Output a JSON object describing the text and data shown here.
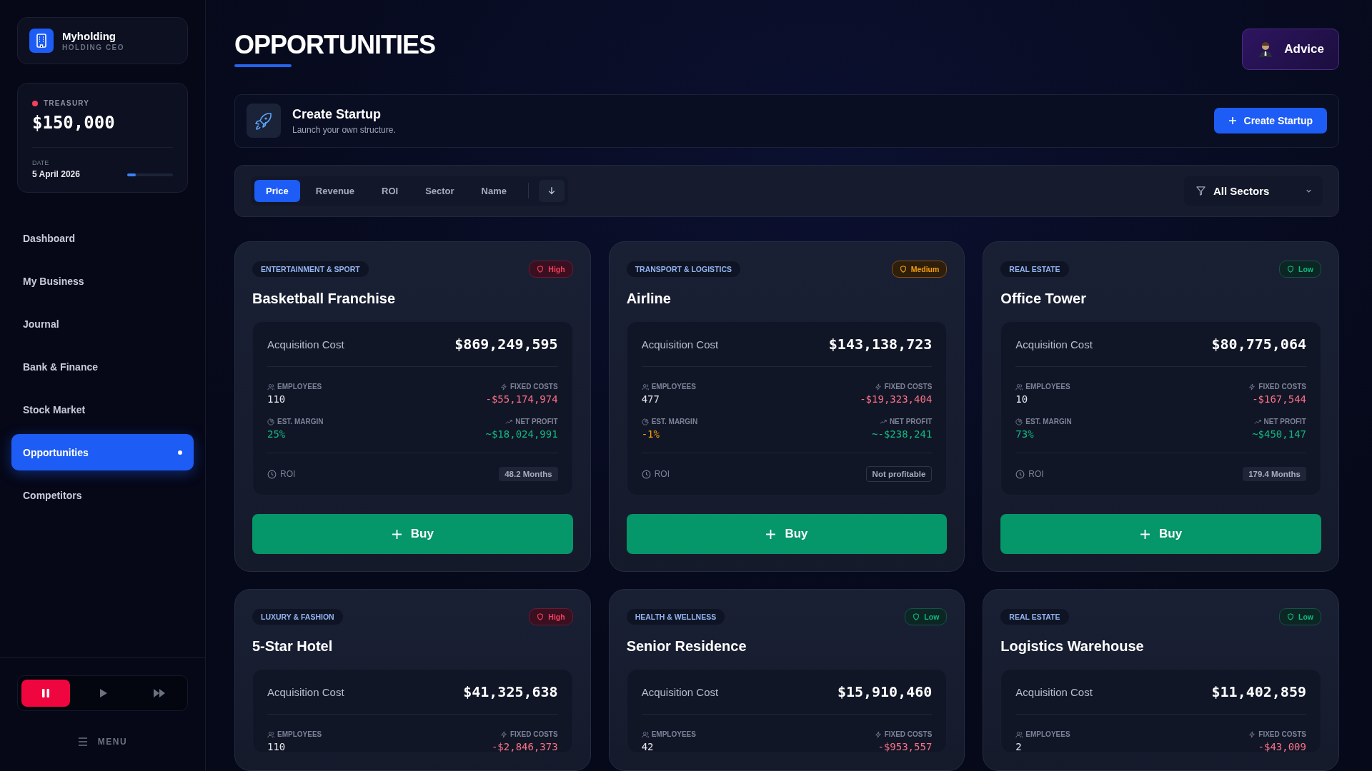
{
  "sidebar": {
    "company": {
      "name": "Myholding",
      "role": "HOLDING CEO"
    },
    "treasury": {
      "label": "TREASURY",
      "color": "#f43f5e",
      "amount": "$150,000",
      "date_label": "DATE",
      "date": "5 April 2026",
      "level": 0.18
    },
    "nav": [
      {
        "label": "Dashboard",
        "selected": false
      },
      {
        "label": "My Business",
        "selected": false
      },
      {
        "label": "Journal",
        "selected": false
      },
      {
        "label": "Bank & Finance",
        "selected": false
      },
      {
        "label": "Stock Market",
        "selected": false
      },
      {
        "label": "Opportunities",
        "selected": true
      },
      {
        "label": "Competitors",
        "selected": false
      }
    ],
    "player": [
      {
        "kind": "pause",
        "selected": true
      },
      {
        "kind": "play",
        "selected": false
      },
      {
        "kind": "fast",
        "selected": false
      }
    ],
    "menu": "MENU"
  },
  "header": {
    "title": "OPPORTUNITIES",
    "advice": "Advice"
  },
  "startup": {
    "title": "Create Startup",
    "subtitle": "Launch your own structure.",
    "button": "Create Startup"
  },
  "sort": {
    "options": [
      {
        "label": "Price",
        "selected": true
      },
      {
        "label": "Revenue",
        "selected": false
      },
      {
        "label": "ROI",
        "selected": false
      },
      {
        "label": "Sector",
        "selected": false
      },
      {
        "label": "Name",
        "selected": false
      }
    ],
    "sector_filter": "All Sectors"
  },
  "cards": [
    {
      "sector": "ENTERTAINMENT & SPORT",
      "risk": {
        "kind": "high",
        "label": "High"
      },
      "title": "Basketball Franchise",
      "cost_label": "Acquisition Cost",
      "cost": "$869,249,595",
      "employees_label": "EMPLOYEES",
      "employees": "110",
      "fixed_label": "FIXED COSTS",
      "fixed": "-$55,174,974",
      "margin_label": "EST. MARGIN",
      "margin": {
        "kind": "positive",
        "value": "25%"
      },
      "profit_label": "NET PROFIT",
      "profit": "~$18,024,991",
      "roi_label": "ROI",
      "roi": {
        "kind": "months",
        "value": "48.2 Months"
      },
      "buy": "Buy"
    },
    {
      "sector": "TRANSPORT & LOGISTICS",
      "risk": {
        "kind": "medium",
        "label": "Medium"
      },
      "title": "Airline",
      "cost_label": "Acquisition Cost",
      "cost": "$143,138,723",
      "employees_label": "EMPLOYEES",
      "employees": "477",
      "fixed_label": "FIXED COSTS",
      "fixed": "-$19,323,404",
      "margin_label": "EST. MARGIN",
      "margin": {
        "kind": "negative",
        "value": "-1%"
      },
      "profit_label": "NET PROFIT",
      "profit": "~-$238,241",
      "roi_label": "ROI",
      "roi": {
        "kind": "none",
        "value": "Not profitable"
      },
      "buy": "Buy"
    },
    {
      "sector": "REAL ESTATE",
      "risk": {
        "kind": "low",
        "label": "Low"
      },
      "title": "Office Tower",
      "cost_label": "Acquisition Cost",
      "cost": "$80,775,064",
      "employees_label": "EMPLOYEES",
      "employees": "10",
      "fixed_label": "FIXED COSTS",
      "fixed": "-$167,544",
      "margin_label": "EST. MARGIN",
      "margin": {
        "kind": "positive",
        "value": "73%"
      },
      "profit_label": "NET PROFIT",
      "profit": "~$450,147",
      "roi_label": "ROI",
      "roi": {
        "kind": "months",
        "value": "179.4 Months"
      },
      "buy": "Buy"
    },
    {
      "sector": "LUXURY & FASHION",
      "risk": {
        "kind": "high",
        "label": "High"
      },
      "title": "5-Star Hotel",
      "cost_label": "Acquisition Cost",
      "cost": "$41,325,638",
      "employees_label": "EMPLOYEES",
      "employees": "110",
      "fixed_label": "FIXED COSTS",
      "fixed": "-$2,846,373"
    },
    {
      "sector": "HEALTH & WELLNESS",
      "risk": {
        "kind": "low",
        "label": "Low"
      },
      "title": "Senior Residence",
      "cost_label": "Acquisition Cost",
      "cost": "$15,910,460",
      "employees_label": "EMPLOYEES",
      "employees": "42",
      "fixed_label": "FIXED COSTS",
      "fixed": "-$953,557"
    },
    {
      "sector": "REAL ESTATE",
      "risk": {
        "kind": "low",
        "label": "Low"
      },
      "title": "Logistics Warehouse",
      "cost_label": "Acquisition Cost",
      "cost": "$11,402,859",
      "employees_label": "EMPLOYEES",
      "employees": "2",
      "fixed_label": "FIXED COSTS",
      "fixed": "-$43,009"
    }
  ]
}
